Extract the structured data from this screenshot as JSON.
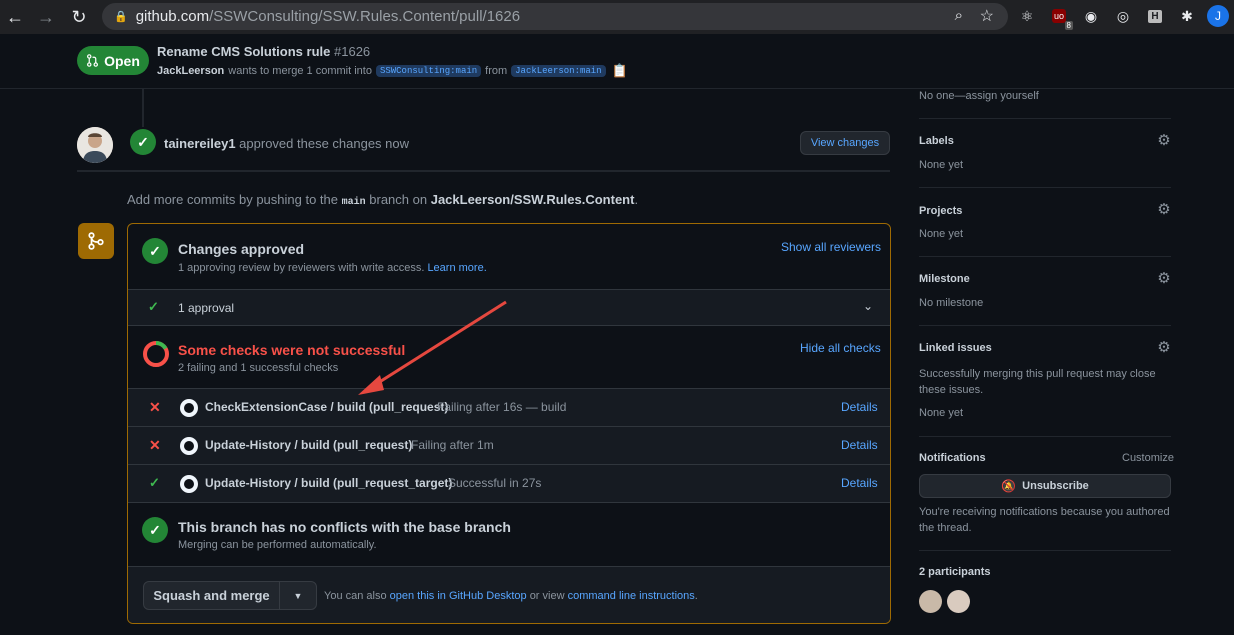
{
  "browser": {
    "url_host": "github.com",
    "url_path": "/SSWConsulting/SSW.Rules.Content/pull/1626",
    "badge_count": "8",
    "profile_initial": "J"
  },
  "pr": {
    "status": "Open",
    "title": "Rename CMS Solutions rule",
    "number": "#1626",
    "author": "JackLeerson",
    "merge_text": "wants to merge 1 commit into",
    "base_branch": "SSWConsulting:main",
    "from_text": "from",
    "head_branch": "JackLeerson:main"
  },
  "timeline": {
    "approver": "tainereiley1",
    "approved_text": "approved these changes now",
    "view_changes": "View changes",
    "add_commits_prefix": "Add more commits by pushing to the",
    "branch_code": "main",
    "add_commits_mid": "branch on",
    "repo": "JackLeerson/SSW.Rules.Content",
    "add_commits_suffix": "."
  },
  "mergebox": {
    "approved_title": "Changes approved",
    "approved_sub": "1 approving review by reviewers with write access.",
    "learn_more": "Learn more.",
    "show_reviewers": "Show all reviewers",
    "approvals": "1 approval",
    "checks_title": "Some checks were not successful",
    "checks_sub": "2 failing and 1 successful checks",
    "hide_checks": "Hide all checks",
    "checks": [
      {
        "name": "CheckExtensionCase / build (pull_request)",
        "status": "Failing after 16s — build",
        "result": "fail",
        "details": "Details"
      },
      {
        "name": "Update-History / build (pull_request)",
        "status": "Failing after 1m",
        "result": "fail",
        "details": "Details"
      },
      {
        "name": "Update-History / build (pull_request_target)",
        "status": "Successful in 27s",
        "result": "pass",
        "details": "Details"
      }
    ],
    "conflicts_title": "This branch has no conflicts with the base branch",
    "conflicts_sub": "Merging can be performed automatically.",
    "merge_button": "Squash and merge",
    "also_prefix": "You can also",
    "open_desktop": "open this in GitHub Desktop",
    "or_view": "or view",
    "cli": "command line instructions",
    "also_suffix": "."
  },
  "sidebar": {
    "assignees_value": "No one—assign yourself",
    "labels": {
      "title": "Labels",
      "value": "None yet"
    },
    "projects": {
      "title": "Projects",
      "value": "None yet"
    },
    "milestone": {
      "title": "Milestone",
      "value": "No milestone"
    },
    "linked": {
      "title": "Linked issues",
      "desc": "Successfully merging this pull request may close these issues.",
      "value": "None yet"
    },
    "notifications": {
      "title": "Notifications",
      "customize": "Customize",
      "button": "Unsubscribe",
      "desc": "You're receiving notifications because you authored the thread."
    },
    "participants": "2 participants"
  },
  "colors": {
    "green": "#238636",
    "red": "#f85149",
    "link": "#58a6ff",
    "annotation_arrow": "#e5483f"
  }
}
